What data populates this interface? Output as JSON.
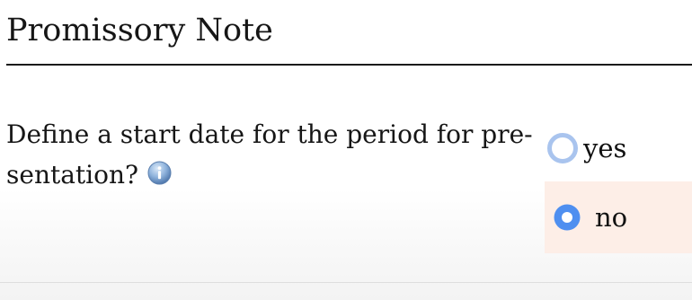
{
  "form": {
    "title": "Promissory Note",
    "question": {
      "text": "Define a start date for the period for pre-sentation?",
      "line1": "Define a start date for the period for pre-",
      "line2": "sentation?",
      "info_icon": "info-icon"
    },
    "options": [
      {
        "label": "yes",
        "selected": false
      },
      {
        "label": "no",
        "selected": true
      }
    ]
  },
  "colors": {
    "radio_accent": "#4f8ff0",
    "selected_background": "#fdeee7",
    "title_rule": "#1b1b1b"
  }
}
